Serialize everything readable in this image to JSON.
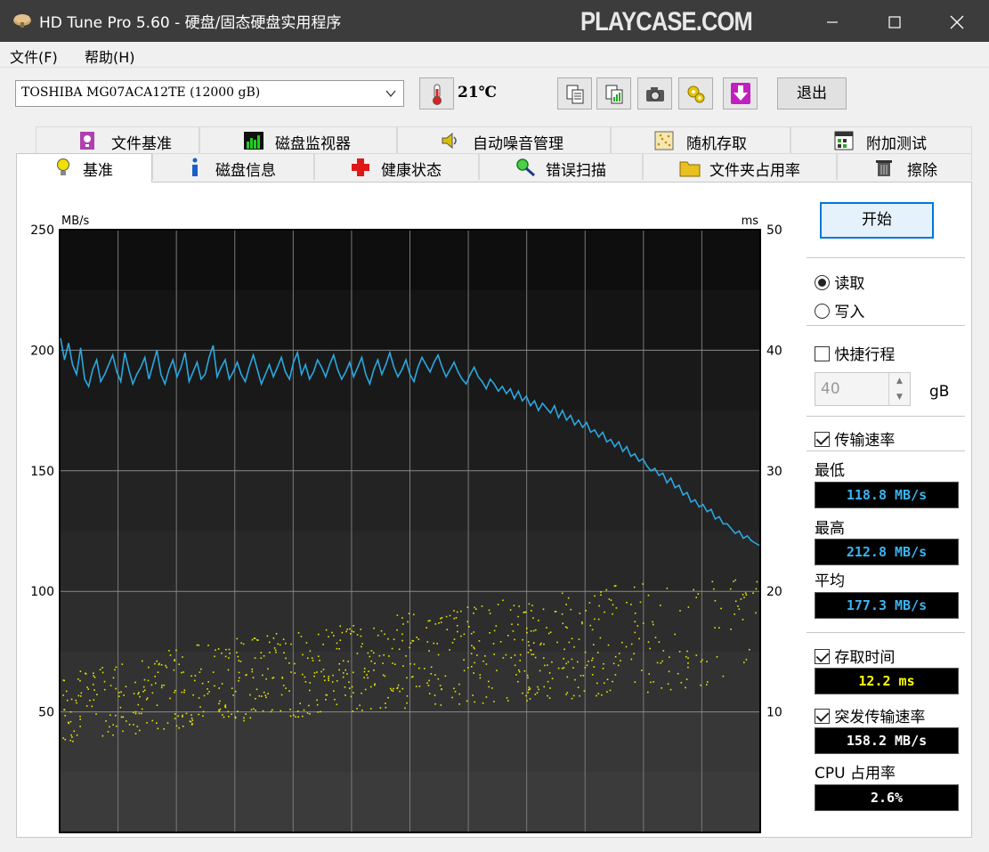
{
  "window": {
    "title": "HD Tune Pro 5.60 - 硬盘/固态硬盘实用程序",
    "watermark": "PLAYCASE.COM"
  },
  "menu": {
    "file": "文件(F)",
    "help": "帮助(H)"
  },
  "toolbar": {
    "drive": "TOSHIBA MG07ACA12TE (12000 gB)",
    "temperature": "21℃",
    "exit_label": "退出"
  },
  "tabs_top": [
    {
      "label": "文件基准",
      "icon": "file-benchmark-icon"
    },
    {
      "label": "磁盘监视器",
      "icon": "disk-monitor-icon"
    },
    {
      "label": "自动噪音管理",
      "icon": "speaker-icon"
    },
    {
      "label": "随机存取",
      "icon": "random-access-icon"
    },
    {
      "label": "附加测试",
      "icon": "extra-tests-icon"
    }
  ],
  "tabs_bottom": [
    {
      "label": "基准",
      "icon": "bulb-icon",
      "active": true
    },
    {
      "label": "磁盘信息",
      "icon": "info-icon"
    },
    {
      "label": "健康状态",
      "icon": "health-cross-icon"
    },
    {
      "label": "错误扫描",
      "icon": "magnifier-icon"
    },
    {
      "label": "文件夹占用率",
      "icon": "folder-icon"
    },
    {
      "label": "擦除",
      "icon": "trash-icon"
    }
  ],
  "controls": {
    "start_label": "开始",
    "read_label": "读取",
    "write_label": "写入",
    "short_stroke_label": "快捷行程",
    "short_stroke_value": "40",
    "gb_unit": "gB",
    "transfer_rate_label": "传输速率",
    "min_label": "最低",
    "min_value": "118.8 MB/s",
    "max_label": "最高",
    "max_value": "212.8 MB/s",
    "avg_label": "平均",
    "avg_value": "177.3 MB/s",
    "access_time_label": "存取时间",
    "access_time_value": "12.2 ms",
    "burst_label": "突发传输速率",
    "burst_value": "158.2 MB/s",
    "cpu_label": "CPU 占用率",
    "cpu_value": "2.6%"
  },
  "colors": {
    "transfer_line": "#2aa8e0",
    "access_points": "#e8e800",
    "chart_bg": "#141414"
  },
  "chart_data": {
    "type": "line",
    "left_axis_unit": "MB/s",
    "right_axis_unit": "ms",
    "y_left_range": [
      0,
      250
    ],
    "y_right_range": [
      0,
      50
    ],
    "y_left_ticks": [
      "250",
      "200",
      "150",
      "100",
      "50"
    ],
    "y_right_ticks": [
      "50",
      "40",
      "30",
      "20",
      "10"
    ],
    "grid": true,
    "series": [
      {
        "values": [
          205,
          196,
          203,
          194,
          190,
          201,
          188,
          185,
          192,
          196,
          187,
          190,
          194,
          198,
          191,
          187,
          199,
          192,
          186,
          190,
          193,
          197,
          188,
          194,
          200,
          190,
          186,
          192,
          196,
          189,
          193,
          199,
          187,
          191,
          195,
          188,
          190,
          197,
          202,
          189,
          193,
          196,
          188,
          191,
          195,
          190,
          187,
          193,
          198,
          192,
          186,
          190,
          194,
          189,
          193,
          197,
          191,
          188,
          195,
          199,
          190,
          194,
          188,
          191,
          196,
          193,
          189,
          194,
          198,
          192,
          188,
          191,
          195,
          189,
          193,
          197,
          190,
          186,
          192,
          196,
          190,
          194,
          199,
          193,
          189,
          192,
          196,
          190,
          187,
          193,
          197,
          194,
          191,
          195,
          198,
          193,
          189,
          192,
          195,
          191,
          188,
          186,
          190,
          193,
          189,
          187,
          184,
          188,
          186,
          183,
          185,
          182,
          184,
          180,
          183,
          179,
          181,
          177,
          179,
          175,
          178,
          176,
          174,
          177,
          172,
          175,
          171,
          173,
          169,
          171,
          168,
          170,
          166,
          167,
          164,
          166,
          162,
          163,
          160,
          162,
          158,
          160,
          156,
          157,
          154,
          155,
          152,
          150,
          151,
          148,
          149,
          145,
          147,
          143,
          144,
          140,
          141,
          137,
          138,
          135,
          136,
          133,
          134,
          130,
          131,
          128,
          128,
          126,
          124,
          125,
          122,
          123,
          121,
          120,
          119
        ]
      }
    ],
    "scatter_ms": {
      "min": 3,
      "max": 21,
      "typical_start": 10,
      "typical_end": 17
    }
  }
}
